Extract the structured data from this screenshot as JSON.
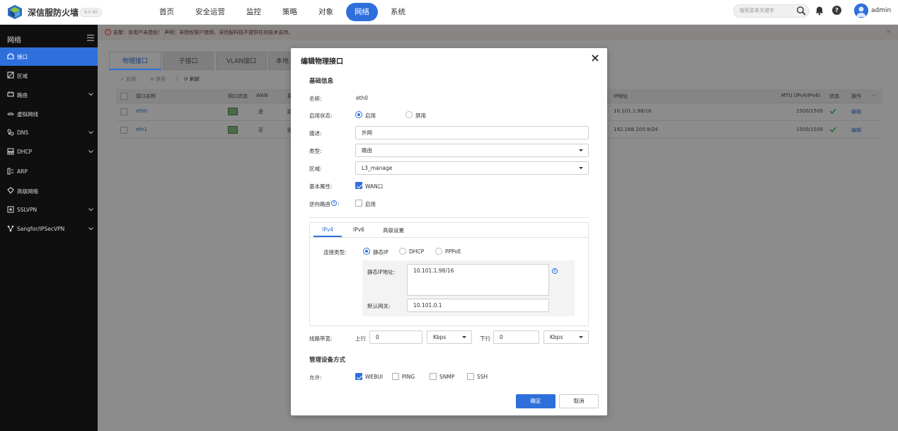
{
  "app": {
    "brand": "深信服防火墙",
    "version": "8.0.60"
  },
  "nav": {
    "items": [
      "首页",
      "安全运营",
      "监控",
      "策略",
      "对象",
      "网络",
      "系统"
    ],
    "active": "网络"
  },
  "header": {
    "search_placeholder": "搜索菜单关键字",
    "username": "admin",
    "help": "?"
  },
  "sidebar": {
    "title": "网络",
    "items": [
      {
        "label": "接口",
        "icon": "interface-icon"
      },
      {
        "label": "区域",
        "icon": "zone-icon"
      },
      {
        "label": "路由",
        "icon": "route-icon"
      },
      {
        "label": "虚拟网线",
        "icon": "virtual-wire-icon"
      },
      {
        "label": "DNS",
        "icon": "dns-icon"
      },
      {
        "label": "DHCP",
        "icon": "dhcp-icon"
      },
      {
        "label": "ARP",
        "icon": "arp-icon"
      },
      {
        "label": "高级网络",
        "icon": "advanced-network-icon"
      },
      {
        "label": "SSLVPN",
        "icon": "sslvpn-icon"
      },
      {
        "label": "Sangfor/IPSecVPN",
        "icon": "ipsecvpn-icon"
      }
    ]
  },
  "alert": {
    "text": "告警：该用户未授权！  声明：非授权客户使用，深信服科技不提供任何技术支持。",
    "close": "×"
  },
  "tabs": [
    "物理接口",
    "子接口",
    "VLAN接口",
    "本地环"
  ],
  "toolbar": {
    "enable": "启用",
    "disable": "禁用",
    "refresh": "刷新",
    "sep": "|"
  },
  "table": {
    "headers": {
      "name": "接口名称",
      "status": "网口状态",
      "wan": "WAN",
      "other": "接",
      "ip": "IP地址",
      "mtu": "MTU (IPv4/IPv6)",
      "state": "状态",
      "op": "操作",
      "more": "···"
    },
    "rows": [
      {
        "name": "eth0",
        "wan": "是",
        "other": "路",
        "ip": "10.101.1.98/16",
        "mtu": "1500/1500",
        "op": "编辑"
      },
      {
        "name": "eth1",
        "wan": "否",
        "other": "路",
        "ip": "192.168.100.9/24",
        "mtu": "1500/1500",
        "op": "编辑"
      }
    ]
  },
  "modal": {
    "title": "编辑物理接口",
    "close": "×",
    "basic": {
      "section": "基础信息",
      "name_label": "名称:",
      "name_value": "eth0",
      "enable_label": "启用状态:",
      "enable_on": "启用",
      "enable_off": "禁用",
      "desc_label": "描述:",
      "desc_value": "外网",
      "type_label": "类型:",
      "type_value": "路由",
      "zone_label": "区域:",
      "zone_value": "L3_manage",
      "attr_label": "基本属性:",
      "attr_wan": "WAN口",
      "reverse_label": "逆向路由",
      "reverse_colon": ":",
      "reverse_enable": "启用"
    },
    "subtabs": [
      "IPv4",
      "IPv6",
      "高级设置"
    ],
    "ipv4": {
      "conn_label": "连接类型:",
      "conn_options": [
        "静态IP",
        "DHCP",
        "PPPoE"
      ],
      "static_ip_label": "静态IP地址:",
      "static_ip_value": "10.101.1.98/16",
      "gateway_label": "默认网关:",
      "gateway_value": "10.101.0.1"
    },
    "bandwidth": {
      "label": "线路带宽:",
      "up_label": "上行",
      "up_value": "0",
      "up_unit": "Kbps",
      "down_label": "下行",
      "down_value": "0",
      "down_unit": "Kbps"
    },
    "manage": {
      "section": "管理设备方式",
      "allow_label": "允许:",
      "options": [
        {
          "label": "WEBUI",
          "checked": true
        },
        {
          "label": "PING",
          "checked": false
        },
        {
          "label": "SNMP",
          "checked": false
        },
        {
          "label": "SSH",
          "checked": false
        }
      ]
    },
    "ok": "确定",
    "cancel": "取消"
  },
  "colors": {
    "accent": "#2f6fdc",
    "sidebar": "#0f0f0f",
    "overlay": "#8c8c8c"
  }
}
